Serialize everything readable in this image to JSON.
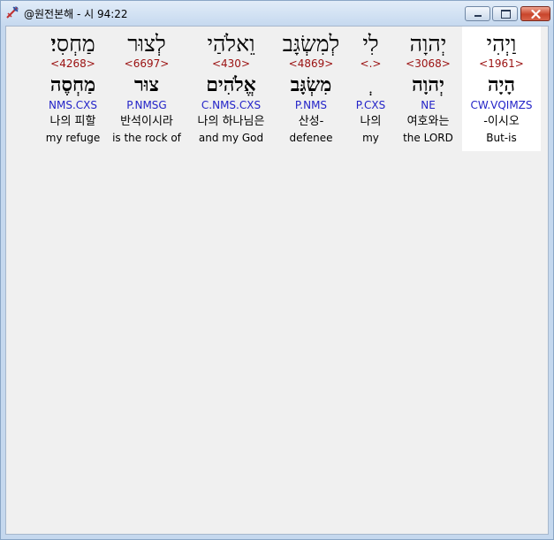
{
  "window": {
    "title": "@원전본해 - 시 94:22"
  },
  "words": [
    {
      "hebrew": "וַיְהִי",
      "strong": "<1961>",
      "lemma": "הָיָה",
      "morph": "CW.VQIMZS",
      "korean": "-이시오",
      "english": "But-is",
      "selected": true
    },
    {
      "hebrew": "יְהוָה",
      "strong": "<3068>",
      "lemma": "יְהוָה",
      "morph": "NE",
      "korean": "여호와는",
      "english": "the LORD",
      "selected": false
    },
    {
      "hebrew": "לִי",
      "strong": "<.>",
      "lemma": "ְ",
      "morph": "P.CXS",
      "korean": "나의",
      "english": "my",
      "selected": false
    },
    {
      "hebrew": "לְמִשְׂגָּב",
      "strong": "<4869>",
      "lemma": "מִשְׂגָּב",
      "morph": "P.NMS",
      "korean": "산성-",
      "english": "defenee",
      "selected": false
    },
    {
      "hebrew": "וֵאלֹהַי",
      "strong": "<430>",
      "lemma": "אֱלֹהִים",
      "morph": "C.NMS.CXS",
      "korean": "나의 하나님은",
      "english": "and my God",
      "selected": false
    },
    {
      "hebrew": "לְצוּר",
      "strong": "<6697>",
      "lemma": "צוּר",
      "morph": "P.NMSG",
      "korean": "반석이시라",
      "english": "is the rock of",
      "selected": false
    },
    {
      "hebrew": "מַחְסִי׃",
      "strong": "<4268>",
      "lemma": "מַחְסֶה",
      "morph": "NMS.CXS",
      "korean": "나의 피할",
      "english": "my refuge",
      "selected": false
    }
  ]
}
